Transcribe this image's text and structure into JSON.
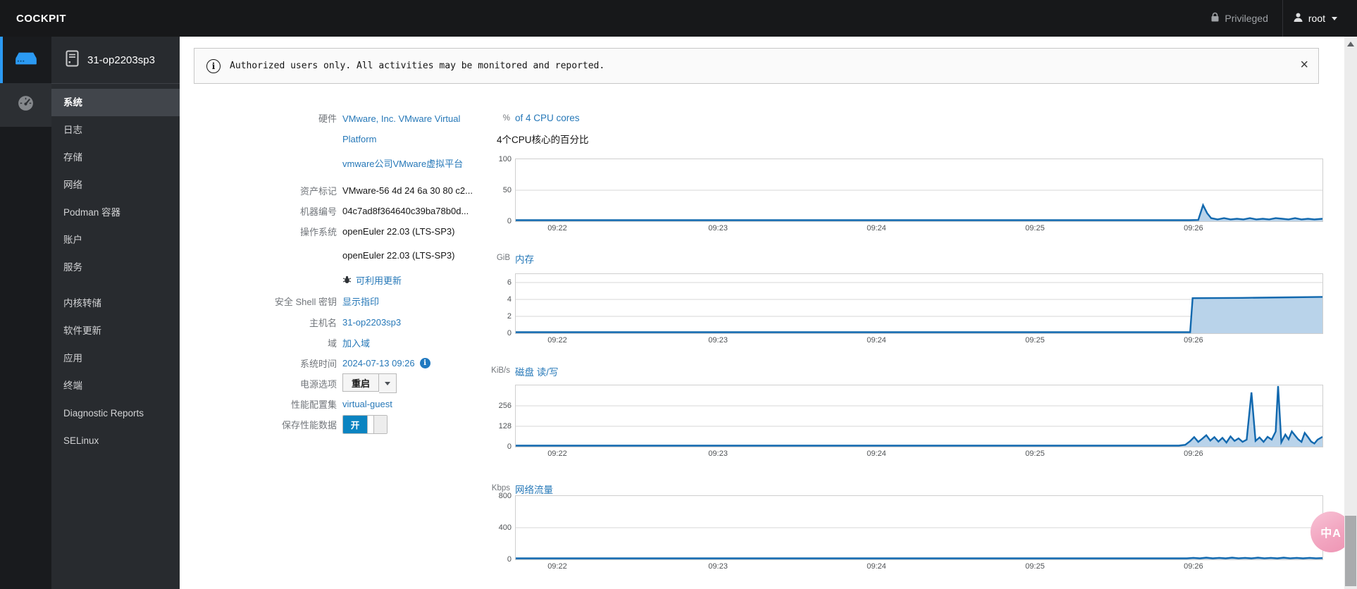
{
  "colors": {
    "link": "#2678b8",
    "chart_line": "#1168ae",
    "chart_fill": "#b9d3ea",
    "toggle_on": "#0a84c1",
    "rail_active": "#2b9af3",
    "masthead_bg": "#17181a"
  },
  "masthead": {
    "brand": "COCKPIT",
    "privileged": "Privileged",
    "user": "root"
  },
  "sidebar": {
    "host": "31-op2203sp3",
    "items": [
      "系统",
      "日志",
      "存储",
      "网络",
      "Podman 容器",
      "账户",
      "服务",
      "内核转储",
      "软件更新",
      "应用",
      "终端",
      "Diagnostic Reports",
      "SELinux"
    ],
    "active_item": "系统"
  },
  "banner": {
    "text": "Authorized users only. All activities may be monitored and reported.",
    "close": "×"
  },
  "system": {
    "hardware_label": "硬件",
    "hardware_link1": "VMware, Inc. VMware Virtual Platform",
    "hardware_link2": "vmware公司VMware虚拟平台",
    "asset_label": "资产标记",
    "asset_value": "VMware-56 4d 24 6a 30 80 c2...",
    "machine_label": "机器编号",
    "machine_value": "04c7ad8f364640c39ba78b0d...",
    "os_label": "操作系统",
    "os_value": "openEuler 22.03 (LTS-SP3)",
    "os_value2": "openEuler 22.03  (LTS-SP3)",
    "updates_link": "可利用更新",
    "ssh_label": "安全 Shell 密钥",
    "ssh_link": "显示指印",
    "hostname_label": "主机名",
    "hostname_link": "31-op2203sp3",
    "domain_label": "域",
    "domain_link": "加入域",
    "time_label": "系统时间",
    "time_link": "2024-07-13 09:26",
    "power_label": "电源选项",
    "power_button": "重启",
    "profile_label": "性能配置集",
    "profile_link": "virtual-guest",
    "pcp_label": "保存性能数据",
    "pcp_on": "开"
  },
  "chart_data": [
    {
      "id": "cpu",
      "type": "area",
      "unit": "%",
      "title": "of 4 CPU cores",
      "subtitle": "4个CPU核心的百分比",
      "ymax": 100,
      "yticks": [
        100,
        50,
        0
      ],
      "x_ticks": [
        "09:22",
        "09:23",
        "09:24",
        "09:25",
        "09:26"
      ],
      "points": [
        [
          0,
          1.2
        ],
        [
          0.1,
          1.2
        ],
        [
          0.2,
          1.2
        ],
        [
          0.3,
          1.2
        ],
        [
          0.4,
          1.2
        ],
        [
          0.5,
          1.2
        ],
        [
          0.6,
          1.2
        ],
        [
          0.7,
          1.2
        ],
        [
          0.8,
          1.2
        ],
        [
          0.835,
          1.2
        ],
        [
          0.846,
          2
        ],
        [
          0.852,
          26
        ],
        [
          0.857,
          13
        ],
        [
          0.862,
          5
        ],
        [
          0.87,
          3
        ],
        [
          0.878,
          5
        ],
        [
          0.886,
          3
        ],
        [
          0.894,
          4
        ],
        [
          0.902,
          3
        ],
        [
          0.91,
          5
        ],
        [
          0.918,
          3
        ],
        [
          0.926,
          4
        ],
        [
          0.934,
          3
        ],
        [
          0.942,
          5
        ],
        [
          0.95,
          4
        ],
        [
          0.958,
          3
        ],
        [
          0.966,
          5
        ],
        [
          0.974,
          3
        ],
        [
          0.982,
          4
        ],
        [
          0.99,
          3
        ],
        [
          1,
          4
        ]
      ]
    },
    {
      "id": "memory",
      "type": "area",
      "unit": "GiB",
      "title": "内存",
      "ymax": 7,
      "yticks": [
        6,
        4,
        2,
        0
      ],
      "x_ticks": [
        "09:22",
        "09:23",
        "09:24",
        "09:25",
        "09:26"
      ],
      "points": [
        [
          0,
          0.12
        ],
        [
          0.2,
          0.12
        ],
        [
          0.4,
          0.12
        ],
        [
          0.6,
          0.12
        ],
        [
          0.8,
          0.12
        ],
        [
          0.836,
          0.12
        ],
        [
          0.839,
          4.15
        ],
        [
          0.9,
          4.18
        ],
        [
          0.96,
          4.25
        ],
        [
          1,
          4.3
        ]
      ]
    },
    {
      "id": "disk",
      "type": "area",
      "unit": "KiB/s",
      "title": "磁盘 读/写",
      "ymax": 384,
      "yticks": [
        256,
        128,
        0
      ],
      "x_ticks": [
        "09:22",
        "09:23",
        "09:24",
        "09:25",
        "09:26"
      ],
      "points": [
        [
          0,
          1
        ],
        [
          0.2,
          1
        ],
        [
          0.4,
          1
        ],
        [
          0.6,
          1
        ],
        [
          0.8,
          1
        ],
        [
          0.822,
          1
        ],
        [
          0.83,
          12
        ],
        [
          0.836,
          35
        ],
        [
          0.841,
          60
        ],
        [
          0.846,
          30
        ],
        [
          0.851,
          50
        ],
        [
          0.856,
          72
        ],
        [
          0.861,
          38
        ],
        [
          0.866,
          60
        ],
        [
          0.871,
          32
        ],
        [
          0.876,
          55
        ],
        [
          0.881,
          26
        ],
        [
          0.886,
          64
        ],
        [
          0.891,
          36
        ],
        [
          0.896,
          52
        ],
        [
          0.901,
          30
        ],
        [
          0.906,
          44
        ],
        [
          0.912,
          340
        ],
        [
          0.917,
          36
        ],
        [
          0.922,
          58
        ],
        [
          0.927,
          30
        ],
        [
          0.932,
          62
        ],
        [
          0.937,
          44
        ],
        [
          0.942,
          95
        ],
        [
          0.945,
          380
        ],
        [
          0.949,
          28
        ],
        [
          0.954,
          76
        ],
        [
          0.958,
          46
        ],
        [
          0.962,
          96
        ],
        [
          0.966,
          70
        ],
        [
          0.97,
          46
        ],
        [
          0.974,
          30
        ],
        [
          0.978,
          86
        ],
        [
          0.982,
          60
        ],
        [
          0.986,
          32
        ],
        [
          0.99,
          20
        ],
        [
          0.994,
          44
        ],
        [
          1,
          62
        ]
      ]
    },
    {
      "id": "network",
      "type": "area",
      "unit": "Kbps",
      "title": "网络流量",
      "ymax": 800,
      "yticks": [
        800,
        400,
        0
      ],
      "x_ticks": [
        "09:22",
        "09:23",
        "09:24",
        "09:25",
        "09:26"
      ],
      "points": [
        [
          0,
          6
        ],
        [
          0.2,
          6
        ],
        [
          0.4,
          6
        ],
        [
          0.6,
          6
        ],
        [
          0.8,
          6
        ],
        [
          0.832,
          6
        ],
        [
          0.84,
          20
        ],
        [
          0.848,
          12
        ],
        [
          0.856,
          22
        ],
        [
          0.864,
          13
        ],
        [
          0.872,
          20
        ],
        [
          0.88,
          13
        ],
        [
          0.888,
          22
        ],
        [
          0.896,
          14
        ],
        [
          0.904,
          20
        ],
        [
          0.912,
          13
        ],
        [
          0.92,
          22
        ],
        [
          0.928,
          14
        ],
        [
          0.936,
          20
        ],
        [
          0.944,
          13
        ],
        [
          0.952,
          22
        ],
        [
          0.96,
          14
        ],
        [
          0.968,
          20
        ],
        [
          0.976,
          13
        ],
        [
          0.984,
          20
        ],
        [
          0.992,
          14
        ],
        [
          1,
          17
        ]
      ]
    }
  ],
  "floating": {
    "translate_glyph": "中A"
  }
}
